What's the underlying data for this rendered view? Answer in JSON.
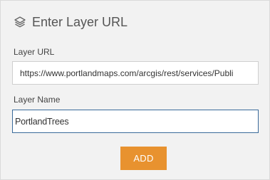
{
  "header": {
    "title": "Enter Layer URL",
    "icon": "layers-icon"
  },
  "form": {
    "url_label": "Layer URL",
    "url_value": "https://www.portlandmaps.com/arcgis/rest/services/Publi",
    "name_label": "Layer Name",
    "name_value": "PortlandTrees",
    "add_label": "ADD"
  },
  "colors": {
    "accent": "#e8922f",
    "panel_bg": "#f2f2f2",
    "focus_border": "#3a6a9a"
  }
}
